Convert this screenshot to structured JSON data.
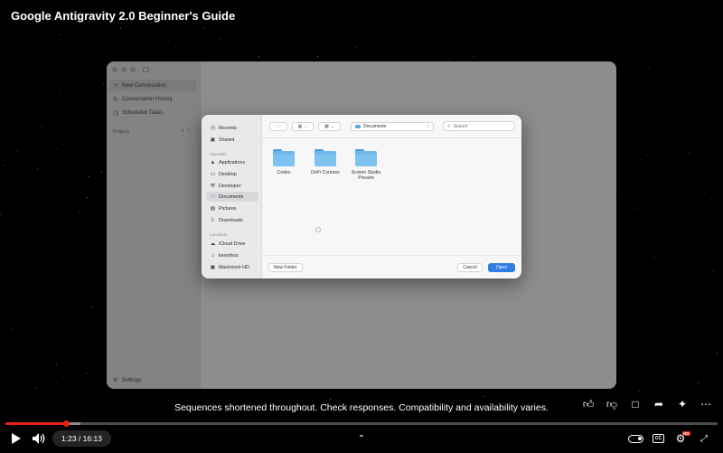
{
  "video": {
    "title": "Google Antigravity 2.0 Beginner's Guide",
    "caption": "Sequences shortened throughout. Check responses. Compatibility and availability varies.",
    "time": "1:23 / 16:13",
    "played_fraction": 0.085,
    "buffered_fraction": 0.105
  },
  "app": {
    "sidebar_items": [
      {
        "icon": "plus-icon",
        "label": "New Conversation"
      },
      {
        "icon": "history-icon",
        "label": "Conversation History"
      },
      {
        "icon": "clock-icon",
        "label": "Scheduled Tasks"
      }
    ],
    "projects_label": "Projects",
    "settings_label": "Settings"
  },
  "dialog": {
    "top_items": [
      {
        "icon": "clock-icon",
        "label": "Recents"
      },
      {
        "icon": "shared-folder-icon",
        "label": "Shared"
      }
    ],
    "favorites_label": "Favorites",
    "favorites": [
      {
        "icon": "applications-icon",
        "label": "Applications"
      },
      {
        "icon": "desktop-icon",
        "label": "Desktop"
      },
      {
        "icon": "hammer-icon",
        "label": "Developer"
      },
      {
        "icon": "document-icon",
        "label": "Documents"
      },
      {
        "icon": "picture-icon",
        "label": "Pictures"
      },
      {
        "icon": "download-icon",
        "label": "Downloads"
      }
    ],
    "locations_label": "Locations",
    "locations": [
      {
        "icon": "cloud-icon",
        "label": "iCloud Drive"
      },
      {
        "icon": "home-icon",
        "label": "kevinhou"
      },
      {
        "icon": "drive-icon",
        "label": "Macintosh HD"
      }
    ],
    "location": "Documents",
    "search_placeholder": "Search",
    "folders": [
      "Codex",
      "DeFi Courses",
      "Screen Studio Presets"
    ],
    "new_folder_label": "New Folder",
    "cancel_label": "Cancel",
    "open_label": "Open"
  },
  "colors": {
    "accent": "#2f7de1",
    "progress": "#e62117",
    "folder": "#6fb7ea"
  }
}
